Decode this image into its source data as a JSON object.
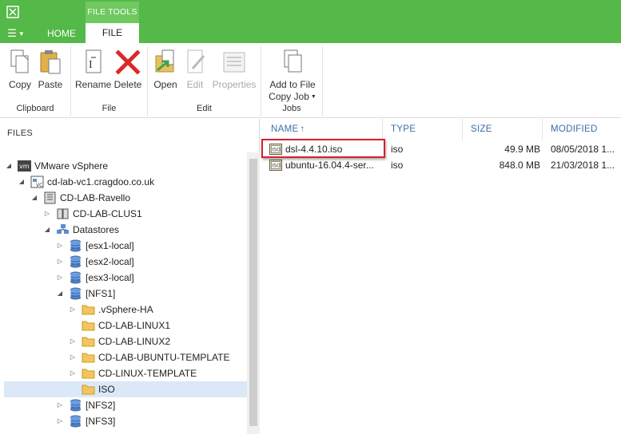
{
  "ribbon_tabs": {
    "context_label": "FILE TOOLS",
    "home": "HOME",
    "file": "FILE"
  },
  "ribbon": {
    "groups": {
      "clipboard": "Clipboard",
      "file": "File",
      "edit": "Edit",
      "jobs": "Jobs"
    },
    "buttons": {
      "copy": "Copy",
      "paste": "Paste",
      "rename": "Rename",
      "delete": "Delete",
      "open": "Open",
      "edit": "Edit",
      "properties": "Properties",
      "add_to_file_line1": "Add to File",
      "add_to_file_line2": "Copy Job"
    }
  },
  "left_pane": {
    "title": "FILES",
    "tree": [
      {
        "label": "VMware vSphere",
        "icon": "vmware-icon",
        "expanded": true
      },
      {
        "label": "cd-lab-vc1.cragdoo.co.uk",
        "icon": "vcenter-icon",
        "expanded": true
      },
      {
        "label": "CD-LAB-Ravello",
        "icon": "datacenter-icon",
        "expanded": true
      },
      {
        "label": "CD-LAB-CLUS1",
        "icon": "cluster-icon",
        "expanded": false
      },
      {
        "label": "Datastores",
        "icon": "datastores-icon",
        "expanded": true
      },
      {
        "label": "[esx1-local]",
        "icon": "datastore-icon",
        "expanded": false
      },
      {
        "label": "[esx2-local]",
        "icon": "datastore-icon",
        "expanded": false
      },
      {
        "label": "[esx3-local]",
        "icon": "datastore-icon",
        "expanded": false
      },
      {
        "label": "[NFS1]",
        "icon": "datastore-icon",
        "expanded": true
      },
      {
        "label": ".vSphere-HA",
        "icon": "folder-icon",
        "expanded": false
      },
      {
        "label": "CD-LAB-LINUX1",
        "icon": "folder-icon",
        "expanded": null
      },
      {
        "label": "CD-LAB-LINUX2",
        "icon": "folder-icon",
        "expanded": false
      },
      {
        "label": "CD-LAB-UBUNTU-TEMPLATE",
        "icon": "folder-icon",
        "expanded": false
      },
      {
        "label": "CD-LINUX-TEMPLATE",
        "icon": "folder-icon",
        "expanded": false
      },
      {
        "label": "ISO",
        "icon": "folder-icon",
        "expanded": null,
        "selected": true
      },
      {
        "label": "[NFS2]",
        "icon": "datastore-icon",
        "expanded": false
      },
      {
        "label": "[NFS3]",
        "icon": "datastore-icon",
        "expanded": false
      }
    ]
  },
  "file_list": {
    "columns": {
      "name": "NAME",
      "type": "TYPE",
      "size": "SIZE",
      "modified": "MODIFIED"
    },
    "rows": [
      {
        "name": "dsl-4.4.10.iso",
        "type": "iso",
        "size": "49.9 MB",
        "modified": "08/05/2018 1..."
      },
      {
        "name": "ubuntu-16.04.4-ser...",
        "type": "iso",
        "size": "848.0 MB",
        "modified": "21/03/2018 1..."
      }
    ]
  },
  "colors": {
    "brand_green": "#54b948",
    "selection": "#dbe8f7",
    "header_text": "#3a6ea5",
    "highlight": "#d7202c"
  }
}
